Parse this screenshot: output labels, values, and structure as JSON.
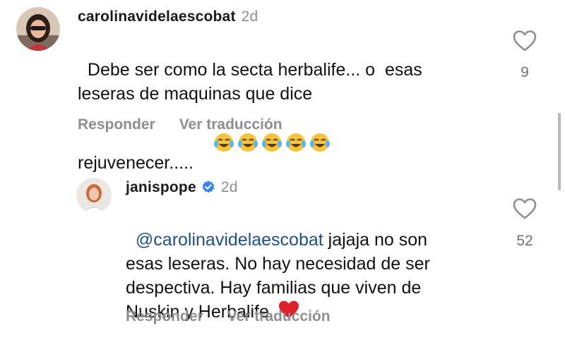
{
  "comments": [
    {
      "username": "carolinavidelaescobat",
      "time": "2d",
      "text": "Debe ser como la secta herbalife... o  esas\nleseras de maquinas que dice\nrejuvenecer.....",
      "emojis": [
        "face-with-tears-of-joy",
        "face-with-tears-of-joy",
        "face-with-tears-of-joy",
        "face-with-tears-of-joy",
        "face-with-tears-of-joy"
      ],
      "likes": "9",
      "reply_label": "Responder",
      "translate_label": "Ver traducción"
    },
    {
      "username": "janispope",
      "time": "2d",
      "verified": true,
      "mention": "@carolinavidelaescobat",
      "text": " jajaja no son\nesas leseras. No hay necesidad de ser\ndespectiva. Hay familias que viven de\nNuskin y Herbalife.",
      "trailing_emoji": "red-heart",
      "likes": "52",
      "reply_label": "Responder",
      "translate_label": "Ver traducción"
    }
  ],
  "colors": {
    "text": "#111111",
    "secondary": "#8e8e8e",
    "mention": "#1d4f8b",
    "verified": "#3b82f6",
    "heart": "#e0212c"
  },
  "icons": [
    "heart-outline-icon",
    "verified-badge-icon"
  ]
}
